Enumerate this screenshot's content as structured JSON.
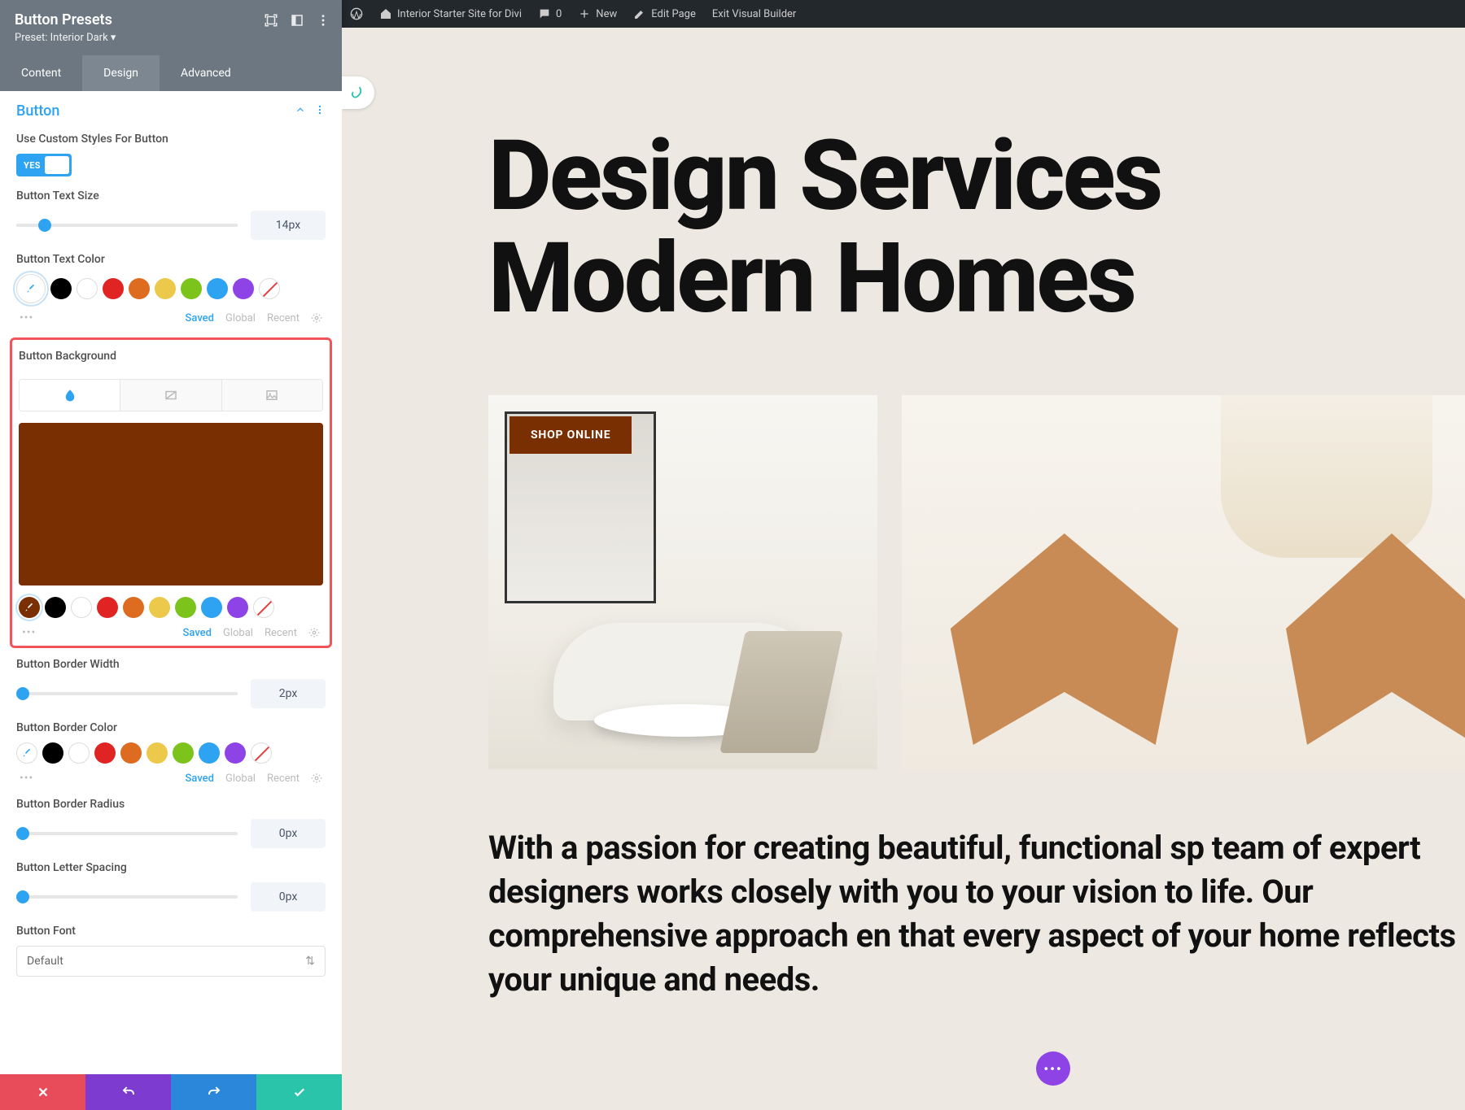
{
  "adminbar": {
    "site": "Interior Starter Site for Divi",
    "comments": "0",
    "new": "New",
    "edit": "Edit Page",
    "exit": "Exit Visual Builder"
  },
  "panel": {
    "title": "Button Presets",
    "preset": "Preset: Interior Dark ▾",
    "tabs": {
      "content": "Content",
      "design": "Design",
      "advanced": "Advanced"
    },
    "section": "Button",
    "fields": {
      "custom_styles_label": "Use Custom Styles For Button",
      "toggle_yes": "YES",
      "text_size_label": "Button Text Size",
      "text_size_value": "14px",
      "text_color_label": "Button Text Color",
      "bg_label": "Button Background",
      "border_width_label": "Button Border Width",
      "border_width_value": "2px",
      "border_color_label": "Button Border Color",
      "border_radius_label": "Button Border Radius",
      "border_radius_value": "0px",
      "letter_spacing_label": "Button Letter Spacing",
      "letter_spacing_value": "0px",
      "font_label": "Button Font",
      "font_value": "Default"
    },
    "subtabs": {
      "saved": "Saved",
      "global": "Global",
      "recent": "Recent"
    }
  },
  "colors": {
    "palette": [
      "#000000",
      "#ffffff",
      "#e02424",
      "#dd6b20",
      "#ecc94b",
      "#48bb78",
      "#38a169",
      "#3182ce",
      "#805ad5"
    ],
    "bg_preview": "#7a2f02",
    "bg_swatch_selected": "#7a2f02"
  },
  "preview": {
    "hero_line1": "Design Services",
    "hero_line2": "Modern Homes",
    "shop_btn": "SHOP ONLINE",
    "paragraph": "With a passion for creating beautiful, functional sp team of expert designers works closely with you to your vision to life. Our comprehensive approach en that every aspect of your home reflects your unique and needs."
  }
}
